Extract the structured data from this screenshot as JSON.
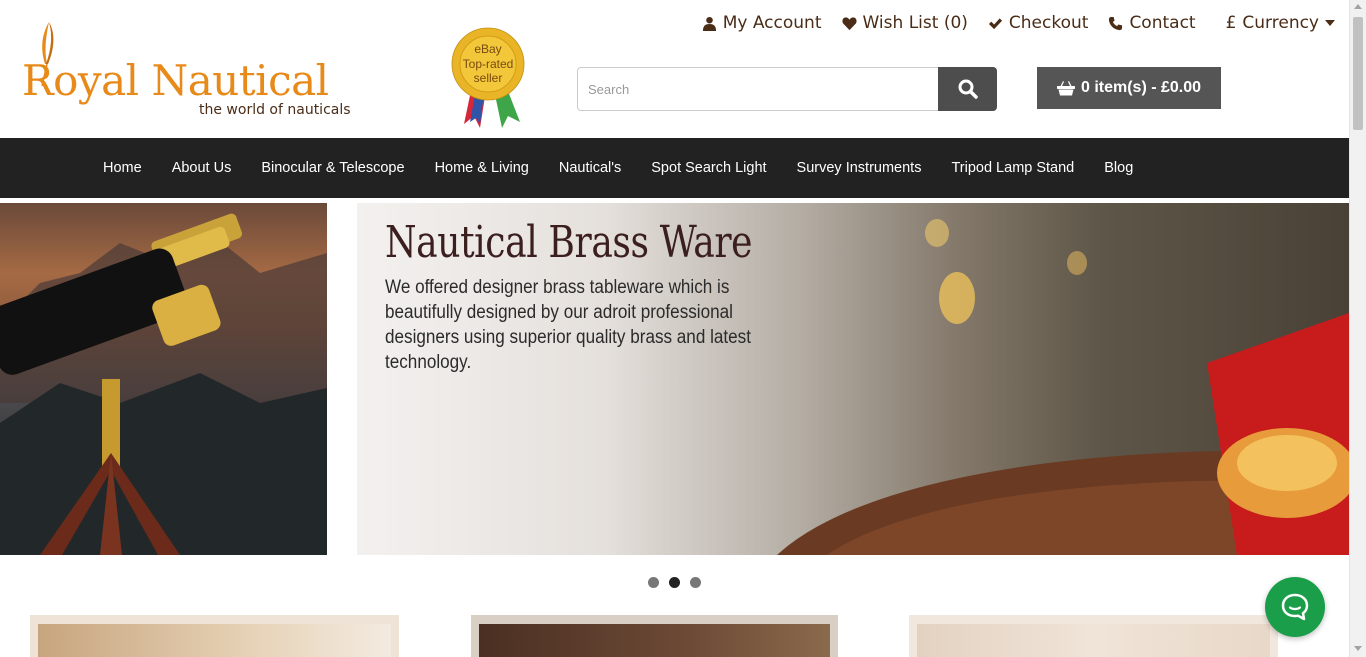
{
  "brand": {
    "name": "Royal Nautical",
    "tagline": "the world of nauticals",
    "badge_line1": "eBay",
    "badge_line2": "Top-rated",
    "badge_line3": "seller"
  },
  "toplinks": {
    "account": "My Account",
    "wishlist": "Wish List (0)",
    "checkout": "Checkout",
    "contact": "Contact",
    "currency_symbol": "£",
    "currency": "Currency"
  },
  "search": {
    "placeholder": "Search"
  },
  "cart": {
    "label": "0 item(s) - £0.00"
  },
  "nav": {
    "items": [
      "Home",
      "About Us",
      "Binocular & Telescope",
      "Home & Living",
      "Nautical's",
      "Spot Search Light",
      "Survey Instruments",
      "Tripod Lamp Stand",
      "Blog"
    ]
  },
  "slide": {
    "title": "Nautical Brass Ware",
    "text": "We offered designer brass tableware which is beautifully designed by our adroit professional designers using superior quality brass and latest technology."
  },
  "carousel": {
    "active_index": 1,
    "count": 3
  },
  "colors": {
    "brand_orange": "#e88a1a",
    "brand_brown": "#4a2c17",
    "nav_bg": "#222222",
    "cart_bg": "#555555",
    "chat_green": "#1a9e4a"
  }
}
